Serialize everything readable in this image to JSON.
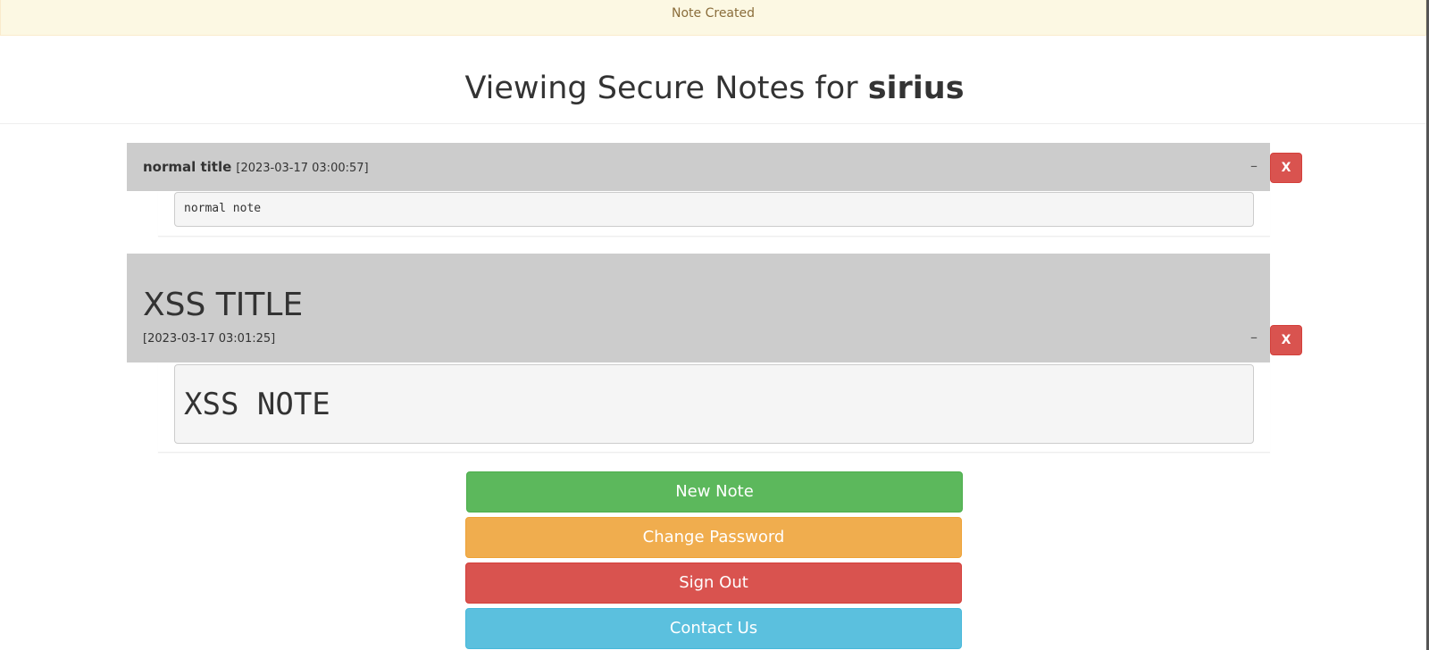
{
  "alert": {
    "message": "Note Created"
  },
  "page": {
    "heading_prefix": "Viewing Secure Notes for",
    "username": "sirius"
  },
  "notes": [
    {
      "title": "normal title",
      "timestamp": "[2023-03-17 03:00:57]",
      "body": "normal note",
      "collapse_label": "–",
      "delete_label": "X"
    },
    {
      "title": "XSS TITLE",
      "timestamp": "[2023-03-17 03:01:25]",
      "body": "XSS NOTE",
      "collapse_label": "–",
      "delete_label": "X"
    }
  ],
  "actions": {
    "new_note": "New Note",
    "change_password": "Change Password",
    "sign_out": "Sign Out",
    "contact_us": "Contact Us"
  },
  "colors": {
    "alert_bg": "#fcf8e3",
    "note_header_bg": "#cccccc",
    "success": "#5cb85c",
    "warning": "#f0ad4e",
    "danger": "#d9534f",
    "info": "#5bc0de"
  }
}
